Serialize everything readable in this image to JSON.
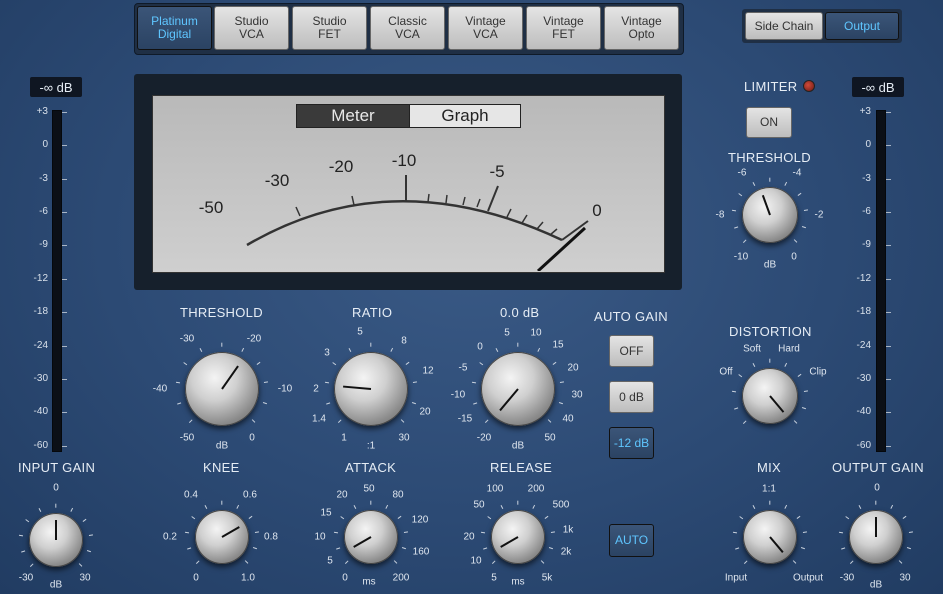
{
  "models": [
    {
      "label": "Platinum\nDigital",
      "active": true
    },
    {
      "label": "Studio\nVCA",
      "active": false
    },
    {
      "label": "Studio\nFET",
      "active": false
    },
    {
      "label": "Classic\nVCA",
      "active": false
    },
    {
      "label": "Vintage\nVCA",
      "active": false
    },
    {
      "label": "Vintage\nFET",
      "active": false
    },
    {
      "label": "Vintage\nOpto",
      "active": false
    }
  ],
  "view_toggle": {
    "side_chain": "Side Chain",
    "output": "Output"
  },
  "input_meter": {
    "value": "-∞ dB",
    "scale": [
      "+3",
      "0",
      "-3",
      "-6",
      "-9",
      "-12",
      "-18",
      "-24",
      "-30",
      "-40",
      "-60"
    ]
  },
  "output_meter": {
    "value": "-∞ dB",
    "scale": [
      "+3",
      "0",
      "-3",
      "-6",
      "-9",
      "-12",
      "-18",
      "-24",
      "-30",
      "-40",
      "-60"
    ]
  },
  "vu": {
    "meter_tab": "Meter",
    "graph_tab": "Graph",
    "scale": [
      "-50",
      "-30",
      "-20",
      "-10",
      "-5",
      "0"
    ]
  },
  "limiter": {
    "label": "LIMITER",
    "on_label": "ON"
  },
  "limiter_threshold": {
    "label": "THRESHOLD",
    "scale": [
      "-6",
      "-4",
      "-8",
      "-2",
      "-10",
      "dB",
      "0"
    ]
  },
  "distortion": {
    "label": "DISTORTION",
    "soft": "Soft",
    "hard": "Hard",
    "off": "Off",
    "clip": "Clip"
  },
  "threshold": {
    "label": "THRESHOLD",
    "scale": [
      "-30",
      "-20",
      "-40",
      "-10",
      "-50",
      "dB",
      "0"
    ]
  },
  "ratio": {
    "label": "RATIO",
    "scale": [
      "5",
      "3",
      "8",
      "2",
      "12",
      "1.4",
      "20",
      "1",
      ":1",
      "30"
    ]
  },
  "makeup": {
    "label": "0.0 dB",
    "scale": [
      "0",
      "5",
      "10",
      "-5",
      "15",
      "-10",
      "20",
      "-15",
      "30",
      "-20",
      "dB",
      "40",
      "50"
    ]
  },
  "auto_gain": {
    "label": "AUTO GAIN",
    "off": "OFF",
    "zero_db": "0 dB",
    "minus12": "-12 dB"
  },
  "input_gain": {
    "label": "INPUT GAIN",
    "scale": [
      "0",
      "-30",
      "dB",
      "30"
    ]
  },
  "knee": {
    "label": "KNEE",
    "scale": [
      "0.4",
      "0.6",
      "0.2",
      "0.8",
      "0",
      "1.0"
    ]
  },
  "attack": {
    "label": "ATTACK",
    "scale": [
      "50",
      "20",
      "80",
      "15",
      "120",
      "10",
      "160",
      "5",
      "0",
      "ms",
      "200"
    ]
  },
  "release": {
    "label": "RELEASE",
    "scale": [
      "100",
      "200",
      "50",
      "500",
      "20",
      "1k",
      "10",
      "2k",
      "5",
      "ms",
      "5k"
    ]
  },
  "auto_release": {
    "label": "AUTO"
  },
  "mix": {
    "label": "MIX",
    "ratio": "1:1",
    "input": "Input",
    "output": "Output"
  },
  "output_gain": {
    "label": "OUTPUT GAIN",
    "scale": [
      "0",
      "-30",
      "dB",
      "30"
    ]
  },
  "colors": {
    "accent": "#5fc6ff",
    "panel": "#2c4a74",
    "led": "#d04a3a"
  }
}
